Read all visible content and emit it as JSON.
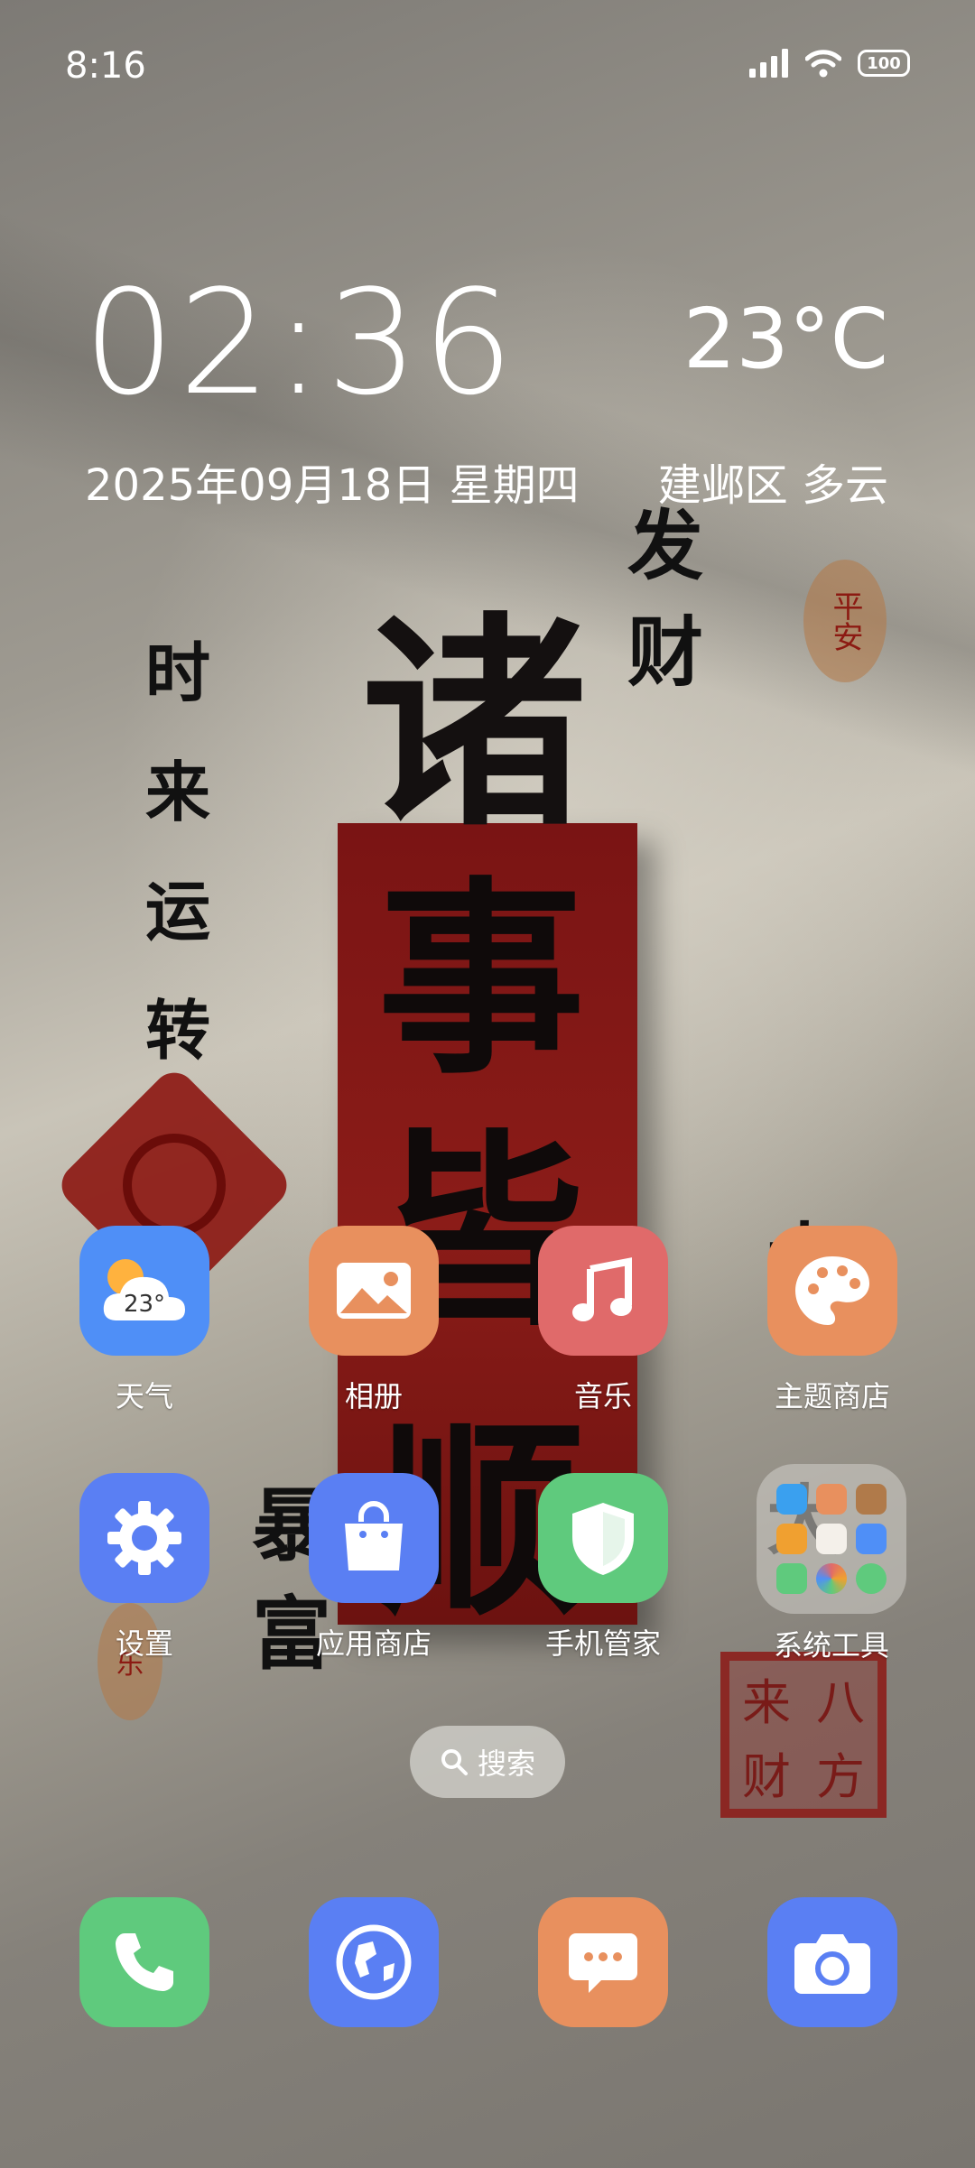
{
  "status_bar": {
    "time": "8:16",
    "battery": "100"
  },
  "clock_widget": {
    "time": "02:36",
    "date": "2025年09月18日 星期四",
    "temperature": "23°C",
    "location_weather": "建邺区 多云"
  },
  "wallpaper": {
    "big_char": "诸",
    "banner_chars": [
      "事",
      "皆",
      "顺"
    ],
    "left_column": [
      "时",
      "来",
      "运",
      "转"
    ],
    "right_top_column": [
      "发",
      "财"
    ],
    "right_mid_column": [
      "大",
      "大"
    ],
    "bottom_left_column": [
      "暴",
      "富"
    ],
    "seal_top": "平安",
    "seal_small": "乐",
    "square_seal": [
      "八",
      "来",
      "方",
      "财"
    ]
  },
  "apps": [
    {
      "label": "天气",
      "icon": "weather-icon",
      "badge": "23°",
      "color": "#4f8ff7"
    },
    {
      "label": "相册",
      "icon": "gallery-icon",
      "color": "#e8905e"
    },
    {
      "label": "音乐",
      "icon": "music-icon",
      "color": "#e06a6a"
    },
    {
      "label": "主题商店",
      "icon": "palette-icon",
      "color": "#e8905e"
    },
    {
      "label": "设置",
      "icon": "gear-icon",
      "color": "#5a7ff3"
    },
    {
      "label": "应用商店",
      "icon": "shopping-bag-icon",
      "color": "#5a7ff3"
    },
    {
      "label": "手机管家",
      "icon": "shield-icon",
      "color": "#5fca7d"
    },
    {
      "label": "系统工具",
      "icon": "folder-icon"
    }
  ],
  "search": {
    "label": "搜索"
  },
  "dock": [
    {
      "icon": "phone-icon",
      "color": "#5fca7d"
    },
    {
      "icon": "browser-icon",
      "color": "#5a7ff3"
    },
    {
      "icon": "messages-icon",
      "color": "#e8905e"
    },
    {
      "icon": "camera-icon",
      "color": "#5a7ff3"
    }
  ]
}
